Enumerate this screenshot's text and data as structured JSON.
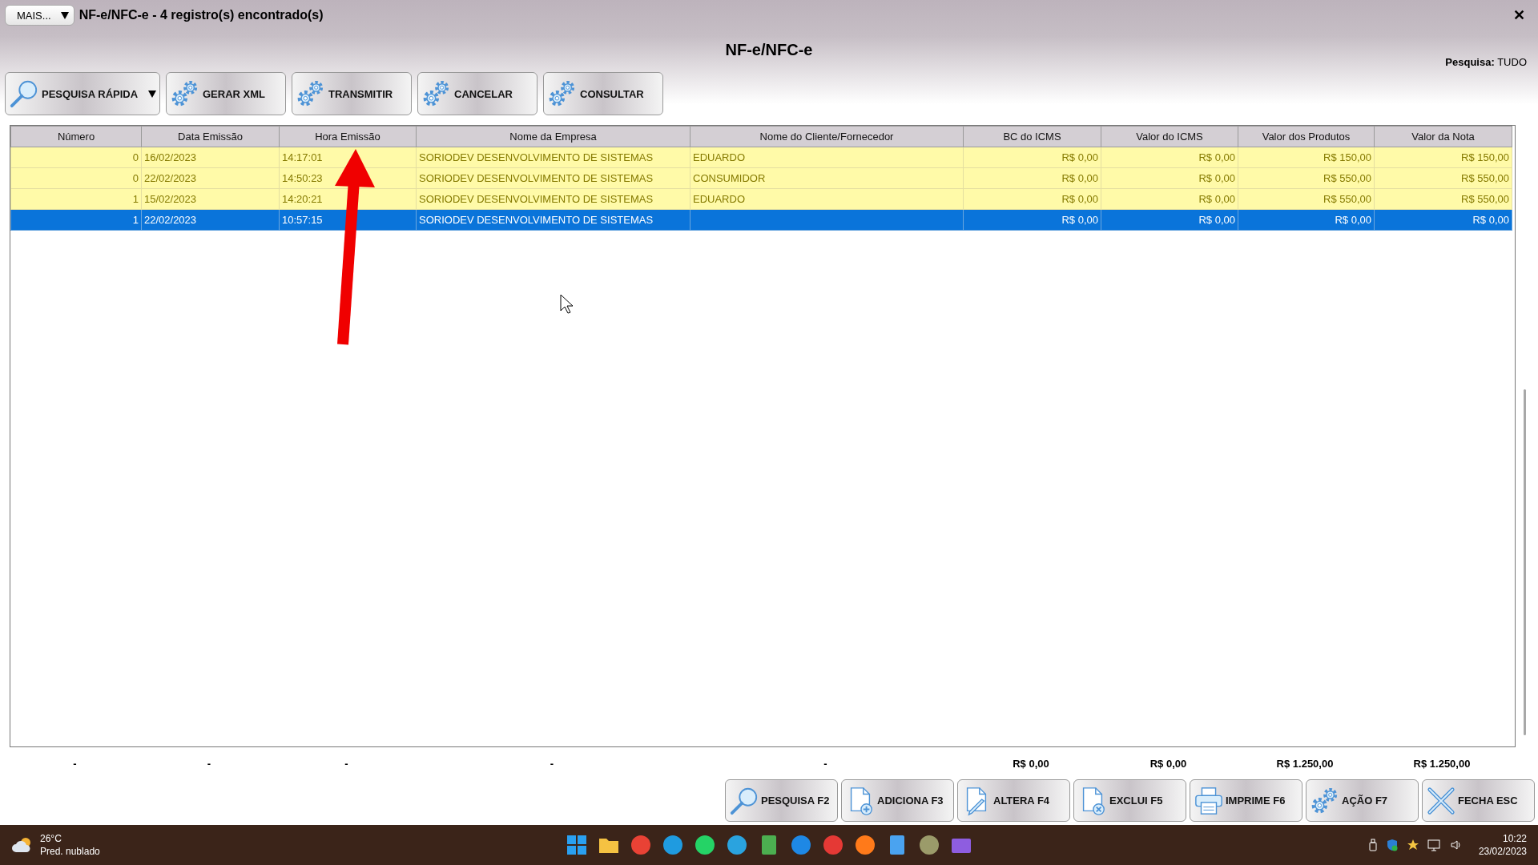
{
  "title_bar": {
    "menu_button": "MAIS...",
    "title": "NF-e/NFC-e - 4 registro(s) encontrado(s)",
    "close": "✕"
  },
  "heading": "NF-e/NFC-e",
  "search_scope": "**Pesquisa:** TUDO",
  "toolbar": [
    {
      "label": "PESQUISA RÁPIDA",
      "kind": "search",
      "dropdown": true
    },
    {
      "label": "GERAR XML",
      "kind": "gears",
      "dropdown": false
    },
    {
      "label": "TRANSMITIR",
      "kind": "gears",
      "dropdown": false
    },
    {
      "label": "CANCELAR",
      "kind": "gears",
      "dropdown": false
    },
    {
      "label": "CONSULTAR",
      "kind": "gears",
      "dropdown": false
    }
  ],
  "table": {
    "columns": [
      "Número",
      "Data Emissão",
      "Hora Emissão",
      "Nome da Empresa",
      "Nome do Cliente/Fornecedor",
      "BC do ICMS",
      "Valor do ICMS",
      "Valor dos Produtos",
      "Valor da Nota"
    ],
    "rows": [
      {
        "selected": false,
        "cells": [
          "0",
          "16/02/2023",
          "14:17:01",
          "SORIODEV DESENVOLVIMENTO DE SISTEMAS",
          "EDUARDO",
          "R$ 0,00",
          "R$ 0,00",
          "R$ 150,00",
          "R$ 150,00"
        ]
      },
      {
        "selected": false,
        "cells": [
          "0",
          "22/02/2023",
          "14:50:23",
          "SORIODEV DESENVOLVIMENTO DE SISTEMAS",
          "CONSUMIDOR",
          "R$ 0,00",
          "R$ 0,00",
          "R$ 550,00",
          "R$ 550,00"
        ]
      },
      {
        "selected": false,
        "cells": [
          "1",
          "15/02/2023",
          "14:20:21",
          "SORIODEV DESENVOLVIMENTO DE SISTEMAS",
          "EDUARDO",
          "R$ 0,00",
          "R$ 0,00",
          "R$ 550,00",
          "R$ 550,00"
        ]
      },
      {
        "selected": true,
        "cells": [
          "1",
          "22/02/2023",
          "10:57:15",
          "SORIODEV DESENVOLVIMENTO DE SISTEMAS",
          "",
          "R$ 0,00",
          "R$ 0,00",
          "R$ 0,00",
          "R$ 0,00"
        ]
      }
    ]
  },
  "totals": [
    "-",
    "-",
    "-",
    "-",
    "-",
    "R$ 0,00",
    "R$ 0,00",
    "R$ 1.250,00",
    "R$ 1.250,00"
  ],
  "actions": [
    {
      "label": "PESQUISA F2",
      "kind": "search"
    },
    {
      "label": "ADICIONA F3",
      "kind": "add"
    },
    {
      "label": "ALTERA F4",
      "kind": "edit"
    },
    {
      "label": "EXCLUI F5",
      "kind": "delete"
    },
    {
      "label": "IMPRIME F6",
      "kind": "print"
    },
    {
      "label": "AÇÃO F7",
      "kind": "action"
    },
    {
      "label": "FECHA ESC",
      "kind": "close"
    }
  ],
  "taskbar": {
    "temperature": "26°C",
    "weather": "Pred. nublado",
    "time": "10:22",
    "date": "23/02/2023"
  }
}
